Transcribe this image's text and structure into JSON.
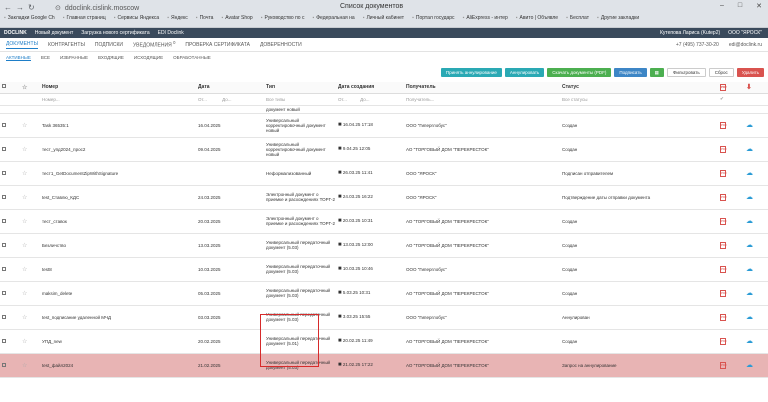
{
  "browser": {
    "url": "ddoclink.cislink.moscow",
    "title": "Список документов",
    "bookmarks": [
      "Закладки Google Ch",
      "Главная страниц",
      "Сервисы Яндекса",
      "Яндекс",
      "Почта",
      "Avatar Shop",
      "Руководство по с",
      "Федеральная на",
      "Личный кабинет",
      "Портал государс",
      "AliExpress - интер",
      "Авито | Объявле",
      "Бесплат",
      "Другие закладки"
    ]
  },
  "app": {
    "logo": "DOCLINK",
    "items": [
      "Новый документ",
      "Загрузка нового сертификата",
      "EDI Doclink"
    ],
    "user": "Кутепова Лариса (Kutep2)",
    "org": "ООО \"ЯРОСК\""
  },
  "tabs": [
    "ДОКУМЕНТЫ",
    "КОНТРАГЕНТЫ",
    "ПОДПИСКИ",
    "УВЕДОМЛЕНИЯ",
    "ПРОВЕРКА СЕРТИФИКАТА",
    "ДОВЕРЕННОСТИ"
  ],
  "notif_count": "0",
  "phone": "+7 (495) 737-30-20",
  "email": "edi@doclink.ru",
  "subtabs": [
    "АКТИВНЫЕ",
    "ВСЕ",
    "ИЗБРАННЫЕ",
    "ВХОДЯЩИЕ",
    "ИСХОДЯЩИЕ",
    "ОБРАБОТАННЫЕ"
  ],
  "toolbar": {
    "annul": "Принять аннулирование",
    "annul2": "Аннулировать",
    "download": "Скачать документы (PDF)",
    "sign": "Подписать",
    "filter": "Фильтровать",
    "reset": "Сброс",
    "delete": "Удалить"
  },
  "columns": [
    "Номер",
    "Дата",
    "Тип",
    "Дата создания",
    "Получатель",
    "Статус"
  ],
  "filters": {
    "number": "Номер...",
    "date_from": "От...",
    "date_to": "До...",
    "type": "Все типы",
    "created_from": "От...",
    "created_to": "До...",
    "recipient": "Получатель...",
    "status": "Все статусы"
  },
  "partial_type": "документ новый",
  "rows": [
    {
      "number": "Task 36535:1",
      "date": "16.04.2025",
      "type": "Универсальный корректировочный документ новый",
      "created": "16.04.25 17:18",
      "recipient": "ООО \"Гиперглобус\"",
      "status": "Создан"
    },
    {
      "number": "тест_упд2024_прос2",
      "date": "09.04.2025",
      "type": "Универсальный корректировочный документ новый",
      "created": "9.04.25 12:05",
      "recipient": "АО \"ТОРГОВЫЙ ДОМ \"ПЕРЕКРЕСТОК\"",
      "status": "Создан"
    },
    {
      "number": "тест1_GetDocumentZipWithSignature",
      "date": "",
      "type": "Неформализованный",
      "created": "26.03.25 11:41",
      "recipient": "ООО \"ЯРОСК\"",
      "status": "Подписан отправителем"
    },
    {
      "number": "test_Ставлю_КДС",
      "date": "24.03.2025",
      "type": "Электронный документ о приемке и расхождениях ТОРГ-2",
      "created": "24.03.25 16:22",
      "recipient": "ООО \"ЯРОСК\"",
      "status": "Подтверждение даты отправки документа"
    },
    {
      "number": "тест_ставок",
      "date": "20.03.2025",
      "type": "Электронный документ о приемке и расхождениях ТОРГ-2",
      "created": "20.03.25 10:31",
      "recipient": "АО \"ТОРГОВЫЙ ДОМ \"ПЕРЕКРЕСТОК\"",
      "status": "Создан"
    },
    {
      "number": "Безличство",
      "date": "13.03.2025",
      "type": "Универсальный передаточный документ (5.03)",
      "created": "13.03.25 12:00",
      "recipient": "АО \"ТОРГОВЫЙ ДОМ \"ПЕРЕКРЕСТОК\"",
      "status": "Создан"
    },
    {
      "number": "test8",
      "date": "10.03.2025",
      "type": "Универсальный передаточный документ (5.03)",
      "created": "10.03.25 10:46",
      "recipient": "ООО \"Гиперглобус\"",
      "status": "Создан"
    },
    {
      "number": "maksim_delete",
      "date": "05.03.2025",
      "type": "Универсальный передаточный документ (5.03)",
      "created": "5.03.25 10:31",
      "recipient": "АО \"ТОРГОВЫЙ ДОМ \"ПЕРЕКРЕСТОК\"",
      "status": "Создан"
    },
    {
      "number": "test_подписание удаленной МЧД",
      "date": "03.03.2025",
      "type": "Универсальный передаточный документ (5.03)",
      "created": "3.03.25 15:55",
      "recipient": "ООО \"Гиперглобус\"",
      "status": "Аннулирован"
    },
    {
      "number": "УПД_new",
      "date": "20.02.2025",
      "type": "Универсальный передаточный документ (5.01)",
      "created": "20.02.25 11:49",
      "recipient": "АО \"ТОРГОВЫЙ ДОМ \"ПЕРЕКРЕСТОК\"",
      "status": "Создан"
    },
    {
      "number": "test_файл2024",
      "date": "21.02.2025",
      "type": "Универсальный передаточный документ (5.03)",
      "created": "21.02.25 17:22",
      "recipient": "АО \"ТОРГОВЫЙ ДОМ \"ПЕРЕКРЕСТОК\"",
      "status": "Запрос на аннулирование"
    }
  ]
}
